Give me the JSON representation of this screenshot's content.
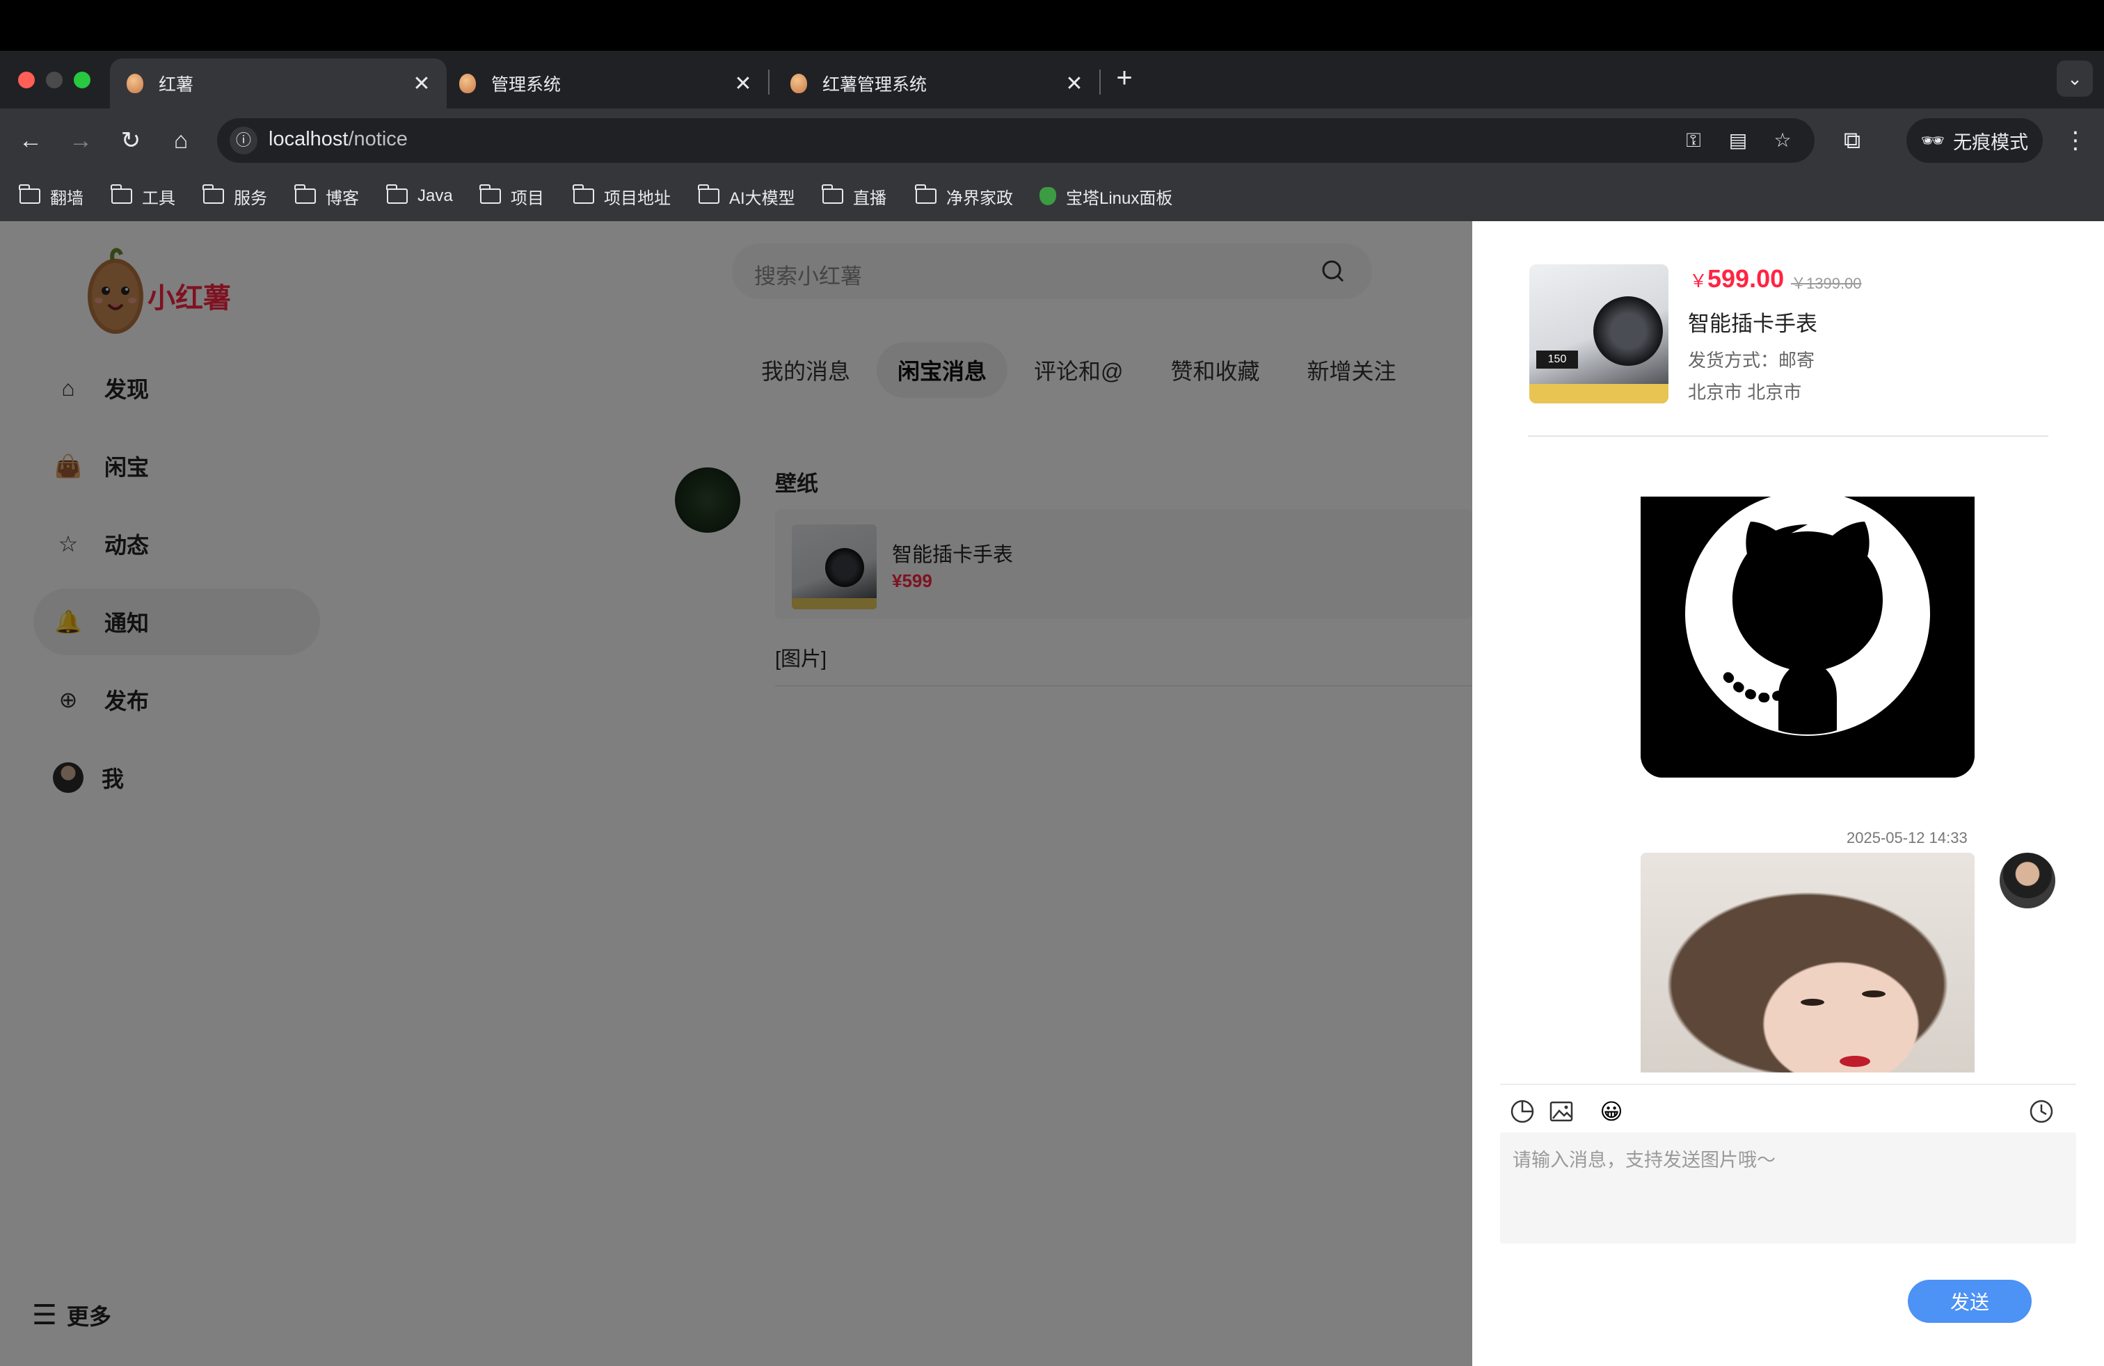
{
  "browser": {
    "tabs": [
      {
        "title": "红薯",
        "active": true
      },
      {
        "title": "管理系统",
        "active": false
      },
      {
        "title": "红薯管理系统",
        "active": false
      }
    ],
    "url_host": "localhost",
    "url_path": "/notice",
    "incognito_label": "无痕模式",
    "bookmarks": [
      "翻墙",
      "工具",
      "服务",
      "博客",
      "Java",
      "项目",
      "项目地址",
      "AI大模型",
      "直播",
      "净界家政",
      "宝塔Linux面板"
    ]
  },
  "app": {
    "logo_text": "小红薯",
    "brand_color": "#ff2442",
    "search_placeholder": "搜索小红薯",
    "nav": [
      {
        "label": "发现",
        "icon": "home-icon"
      },
      {
        "label": "闲宝",
        "icon": "bag-icon"
      },
      {
        "label": "动态",
        "icon": "star-icon"
      },
      {
        "label": "通知",
        "icon": "bell-icon",
        "active": true
      },
      {
        "label": "发布",
        "icon": "plus-circle-icon"
      },
      {
        "label": "我",
        "icon": "avatar"
      }
    ],
    "more_label": "更多"
  },
  "notice": {
    "tabs": [
      "我的消息",
      "闲宝消息",
      "评论和@",
      "赞和收藏",
      "新增关注"
    ],
    "active_tab": "闲宝消息",
    "item": {
      "user": "壁纸",
      "goods_name": "智能插卡手表",
      "goods_price": "¥599",
      "message": "[图片]"
    }
  },
  "chat": {
    "product": {
      "currency": "￥",
      "price": "599.00",
      "original_price": "￥1399.00",
      "title": "智能插卡手表",
      "shipping": "发货方式：邮寄",
      "location": "北京市 北京市",
      "thumb_badge": "150"
    },
    "timestamp": "2025-05-12 14:33",
    "input_placeholder": "请输入消息，支持发送图片哦～",
    "send_label": "发送",
    "send_color": "#4d92f5"
  }
}
